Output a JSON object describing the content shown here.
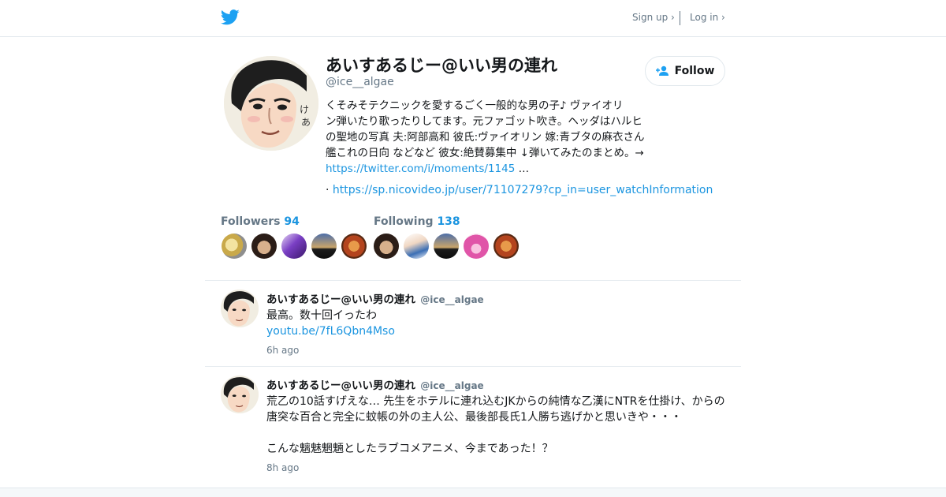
{
  "header": {
    "logo_icon": "twitter-bird-icon",
    "signup_label": "Sign up ›",
    "login_label": "Log in ›"
  },
  "profile": {
    "display_name": "あいすあるじー@いい男の連れ",
    "screen_name": "@ice__algae",
    "follow_label": "Follow",
    "bio_lines": [
      "くそみそテクニックを愛するごく一般的な男の子♪ ヴァイオリ",
      "ン弾いたり歌ったりしてます。元ファゴット吹き。ヘッダはハルヒ",
      "の聖地の写真 夫:阿部高和 彼氏:ヴァイオリン 嫁:青ブタの麻衣さん",
      "艦これの日向 などなど 彼女:絶賛募集中 ↓弾いてみたのまとめ。→"
    ],
    "bio_link": "https://twitter.com/i/moments/1145",
    "bio_ellipsis": " …",
    "url_prefix": "· ",
    "url": "https://sp.nicovideo.jp/user/71107279?cp_in=user_watchInformation"
  },
  "stats": {
    "followers_label": "Followers",
    "followers_count": "94",
    "following_label": "Following",
    "following_count": "138"
  },
  "tweets": [
    {
      "name": "あいすあるじー@いい男の連れ",
      "handle": "@ice__algae",
      "text": "最高。数十回イったわ",
      "link": "youtu.be/7fL6Qbn4Mso",
      "time": "6h ago"
    },
    {
      "name": "あいすあるじー@いい男の連れ",
      "handle": "@ice__algae",
      "text_line1": "荒乙の10話すげえな… 先生をホテルに連れ込むJKからの純情な乙漢にNTRを仕掛け、からの",
      "text_line2": "唐突な百合と完全に蚊帳の外の主人公、最後部長氏1人勝ち逃げかと思いきや・・・",
      "text_line3": "こんな魑魅魍魎としたラブコメアニメ、今まであった！？",
      "time": "8h ago"
    }
  ],
  "colors": {
    "accent": "#1b95e0",
    "twitter_blue": "#1da1f2",
    "muted": "#657786",
    "divider": "#e6ecf0"
  }
}
